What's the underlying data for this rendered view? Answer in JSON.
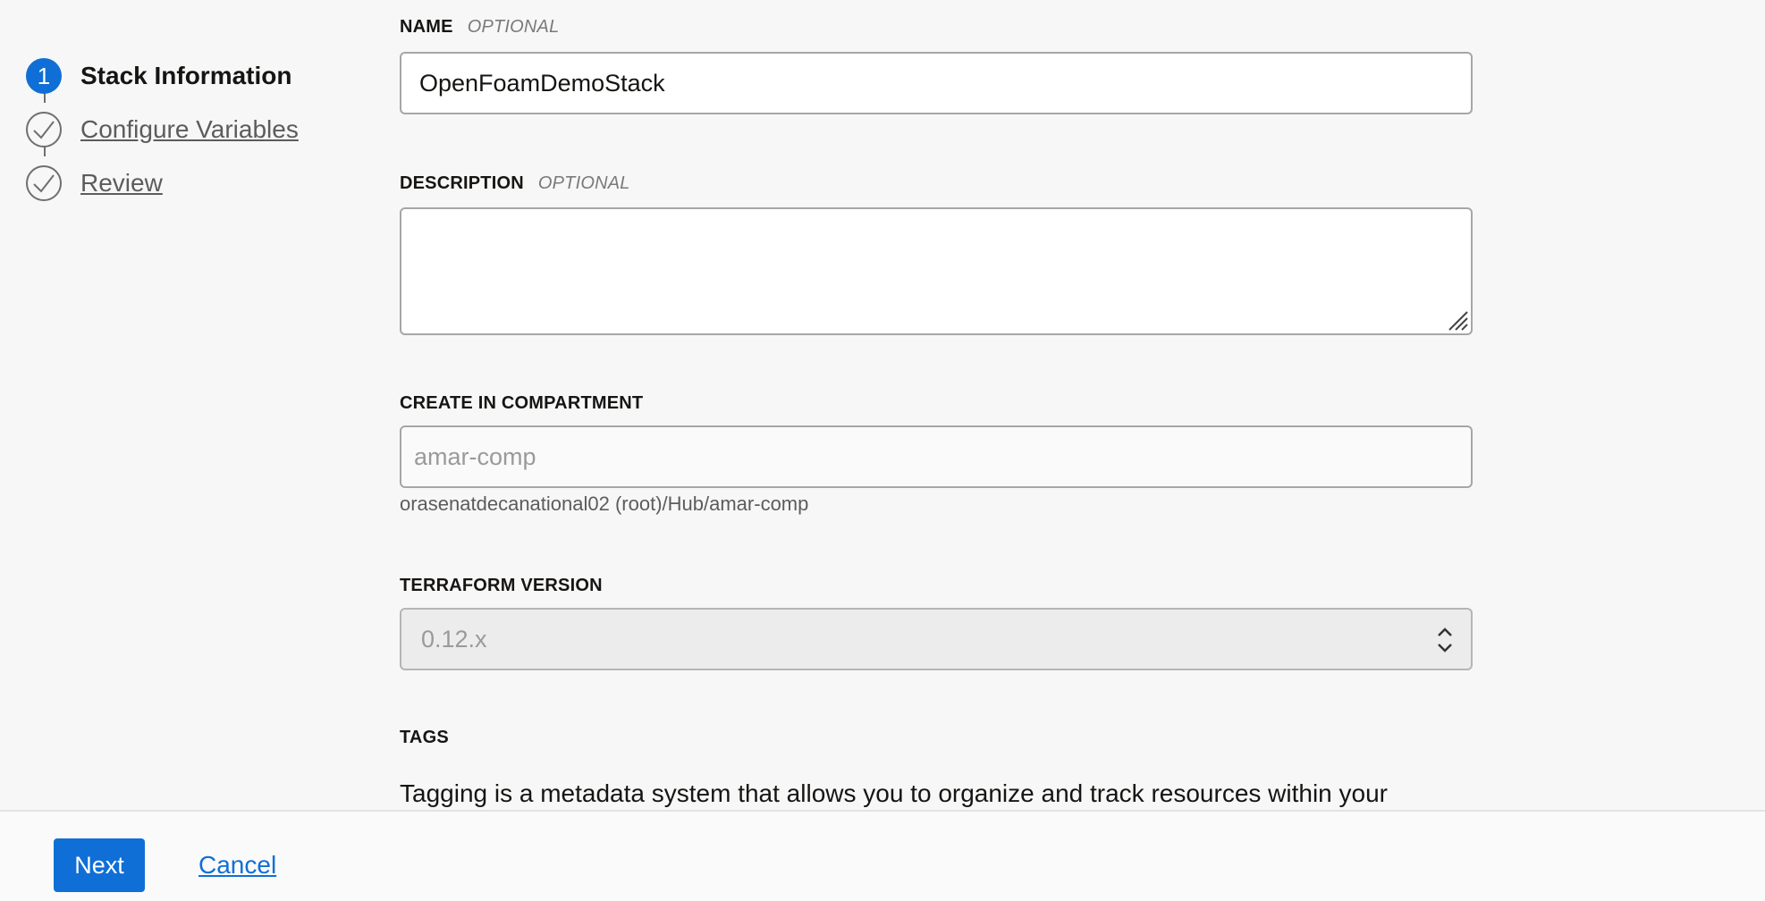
{
  "stepper": {
    "steps": [
      {
        "number": "1",
        "label": "Stack Information",
        "state": "current"
      },
      {
        "label": "Configure Variables",
        "state": "complete"
      },
      {
        "label": "Review",
        "state": "complete"
      }
    ]
  },
  "form": {
    "name": {
      "label": "NAME",
      "optional": "OPTIONAL",
      "value": "OpenFoamDemoStack"
    },
    "description": {
      "label": "DESCRIPTION",
      "optional": "OPTIONAL",
      "value": ""
    },
    "compartment": {
      "label": "CREATE IN COMPARTMENT",
      "value": "amar-comp",
      "path": "orasenatdecanational02 (root)/Hub/amar-comp"
    },
    "terraform": {
      "label": "TERRAFORM VERSION",
      "value": "0.12.x"
    },
    "tags": {
      "label": "TAGS",
      "description": "Tagging is a metadata system that allows you to organize and track resources within your"
    }
  },
  "footer": {
    "next_label": "Next",
    "cancel_label": "Cancel"
  },
  "colors": {
    "accent": "#0f6fd6",
    "background": "#f7f7f7"
  },
  "icons": {
    "step_complete": "check-icon",
    "select": "chevron-up-down-icon",
    "textarea_resize": "resize-grip-icon"
  }
}
